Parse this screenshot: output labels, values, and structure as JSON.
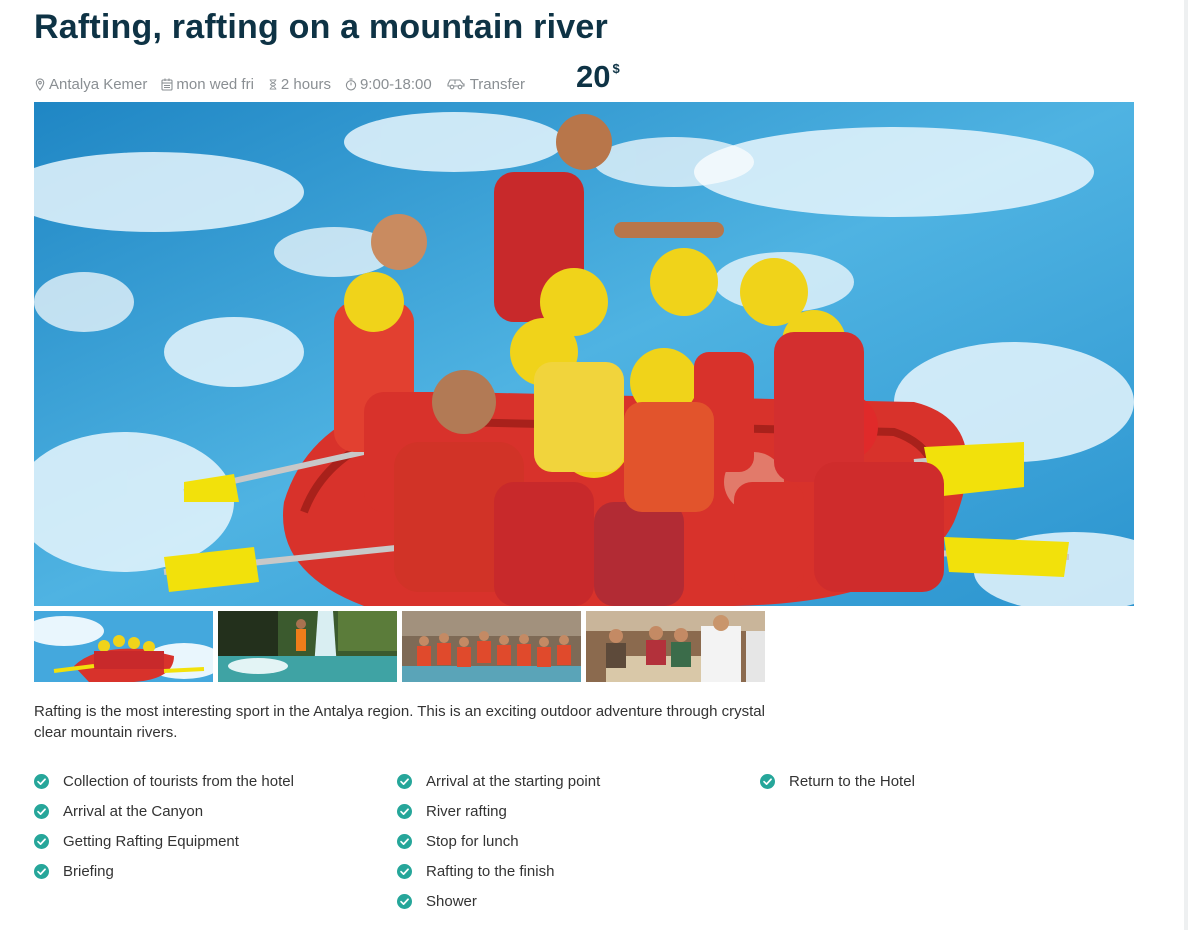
{
  "tour": {
    "title": "Rafting, rafting on a mountain river",
    "meta": {
      "location": "Antalya Kemer",
      "days": "mon wed fri",
      "duration": "2 hours",
      "time": "9:00-18:00",
      "transfer": "Transfer"
    },
    "price": {
      "value": "20",
      "currency": "$"
    },
    "description": "Rafting is the most interesting sport in the Antalya region. This is an exciting outdoor adventure through crystal clear mountain rivers."
  },
  "icons": {
    "location": "location-pin-icon",
    "days": "calendar-icon",
    "duration": "hourglass-icon",
    "time": "stopwatch-icon",
    "transfer": "car-icon",
    "check": "check-circle-icon"
  },
  "gallery": {
    "main_image": "rafting team in a red raft on white water",
    "thumbnails": [
      "rafting team on white water",
      "waterfall canyon",
      "group photo in canyon",
      "lunch at buffet"
    ]
  },
  "program": {
    "column1": [
      "Collection of tourists from the hotel",
      "Arrival at the Canyon",
      "Getting Rafting Equipment",
      "Briefing"
    ],
    "column2": [
      "Arrival at the starting point",
      "River rafting",
      "Stop for lunch",
      "Rafting to the finish",
      "Shower"
    ],
    "column3": [
      "Return to the Hotel"
    ]
  },
  "colors": {
    "title": "#0e3345",
    "meta_text": "#8a8f93",
    "check": "#26a69a",
    "body_text": "#333333"
  }
}
